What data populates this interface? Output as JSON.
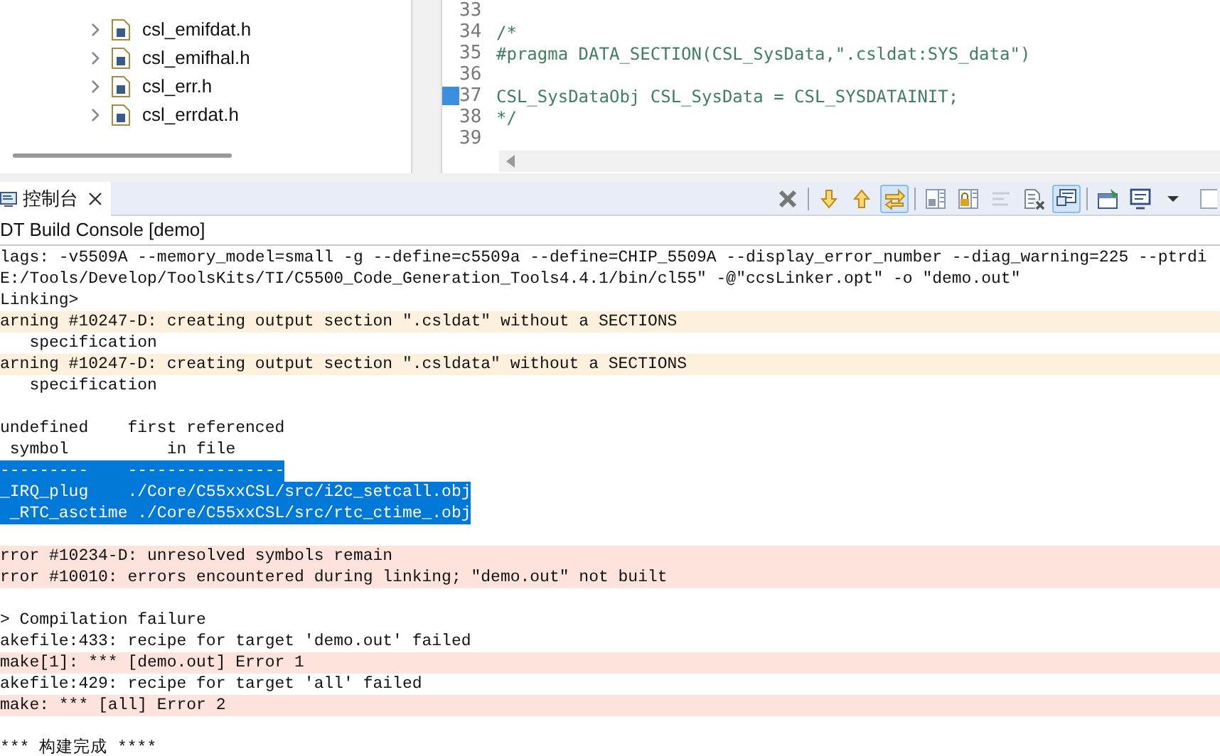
{
  "project_tree": {
    "items": [
      {
        "label": "csl_emifdat.h",
        "expanded": false
      },
      {
        "label": "csl_emifhal.h",
        "expanded": false
      },
      {
        "label": "csl_err.h",
        "expanded": false
      },
      {
        "label": "csl_errdat.h",
        "expanded": false
      }
    ]
  },
  "editor": {
    "lines": [
      {
        "number": "33",
        "marker": false
      },
      {
        "number": "34",
        "code": "/*",
        "marker": false
      },
      {
        "number": "35",
        "code": "#pragma DATA_SECTION(CSL_SysData,\".csldat:SYS_data\")",
        "marker": false
      },
      {
        "number": "36",
        "marker": false
      },
      {
        "number": "37",
        "code": "CSL_SysDataObj CSL_SysData = CSL_SYSDATAINIT;",
        "marker": true
      },
      {
        "number": "38",
        "code": "*/",
        "marker": false
      },
      {
        "number": "39",
        "marker": false
      }
    ]
  },
  "console_tab": {
    "label": "控制台",
    "selected": true
  },
  "toolbar": [
    {
      "kind": "clear",
      "selected": false
    },
    {
      "kind": "sep"
    },
    {
      "kind": "down",
      "selected": false
    },
    {
      "kind": "up",
      "selected": false
    },
    {
      "kind": "link",
      "selected": true
    },
    {
      "kind": "sep"
    },
    {
      "kind": "save",
      "selected": false
    },
    {
      "kind": "lock",
      "selected": false
    },
    {
      "kind": "lines",
      "selected": false
    },
    {
      "kind": "remove",
      "selected": false
    },
    {
      "kind": "display",
      "selected": true
    },
    {
      "kind": "sep"
    },
    {
      "kind": "pin",
      "selected": false
    },
    {
      "kind": "monitor",
      "selected": false
    },
    {
      "kind": "caret",
      "selected": false
    },
    {
      "kind": "window",
      "selected": false
    }
  ],
  "console": {
    "title": "DT Build Console [demo]",
    "lines": [
      {
        "kind": "normal",
        "text": "lags: -v5509A --memory_model=small -g --define=c5509a --define=CHIP_5509A --display_error_number --diag_warning=225 --ptrdi"
      },
      {
        "kind": "normal",
        "text": "E:/Tools/Develop/ToolsKits/TI/C5500_Code_Generation_Tools4.4.1/bin/cl55\" -@\"ccsLinker.opt\" -o \"demo.out\""
      },
      {
        "kind": "normal",
        "text": "Linking>"
      },
      {
        "kind": "warning",
        "text": "arning #10247-D: creating output section \".csldat\" without a SECTIONS"
      },
      {
        "kind": "normal",
        "text": "   specification"
      },
      {
        "kind": "warning",
        "text": "arning #10247-D: creating output section \".csldata\" without a SECTIONS"
      },
      {
        "kind": "normal",
        "text": "   specification"
      },
      {
        "kind": "blank"
      },
      {
        "kind": "normal",
        "text": "undefined    first referenced"
      },
      {
        "kind": "normal",
        "text": " symbol          in file"
      },
      {
        "kind": "selected",
        "text": "---------    ----------------"
      },
      {
        "kind": "selected",
        "text": "_IRQ_plug    ./Core/C55xxCSL/src/i2c_setcall.obj"
      },
      {
        "kind": "selected",
        "text": " _RTC_asctime ./Core/C55xxCSL/src/rtc_ctime_.obj"
      },
      {
        "kind": "blank"
      },
      {
        "kind": "error",
        "text": "rror #10234-D: unresolved symbols remain"
      },
      {
        "kind": "error",
        "text": "rror #10010: errors encountered during linking; \"demo.out\" not built"
      },
      {
        "kind": "blank"
      },
      {
        "kind": "normal",
        "text": "> Compilation failure"
      },
      {
        "kind": "normal",
        "text": "akefile:433: recipe for target 'demo.out' failed"
      },
      {
        "kind": "error",
        "text": "make[1]: *** [demo.out] Error 1"
      },
      {
        "kind": "normal",
        "text": "akefile:429: recipe for target 'all' failed"
      },
      {
        "kind": "error",
        "text": "make: *** [all] Error 2"
      },
      {
        "kind": "blank"
      },
      {
        "kind": "normal",
        "text": "*** 构建完成 ****"
      }
    ]
  }
}
